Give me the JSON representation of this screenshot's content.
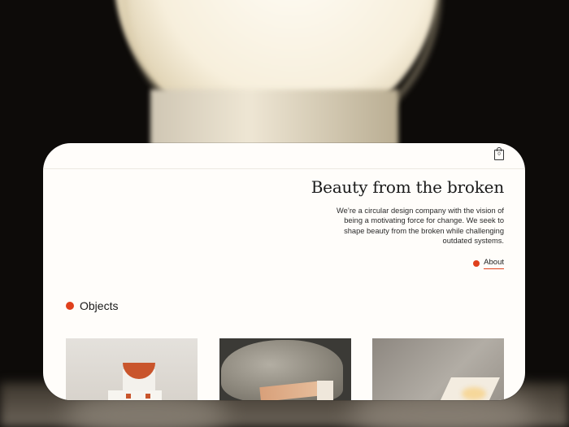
{
  "header": {
    "cart_count": "0"
  },
  "hero": {
    "title": "Beauty from the broken",
    "description": "We’re a circular design company with the vision of being a motivating force for change. We seek to shape beauty from the broken while challenging outdated systems.",
    "about_link": "About"
  },
  "objects": {
    "heading": "Objects",
    "items": [
      {
        "image": "ceramic-arc-object"
      },
      {
        "image": "stone-and-wood-object"
      },
      {
        "image": "folded-paper-lamp-object"
      }
    ]
  },
  "colors": {
    "accent": "#e0401c",
    "card_background": "#fffdfa",
    "page_background": "#0d0b09"
  },
  "icons": [
    "cart-icon"
  ]
}
